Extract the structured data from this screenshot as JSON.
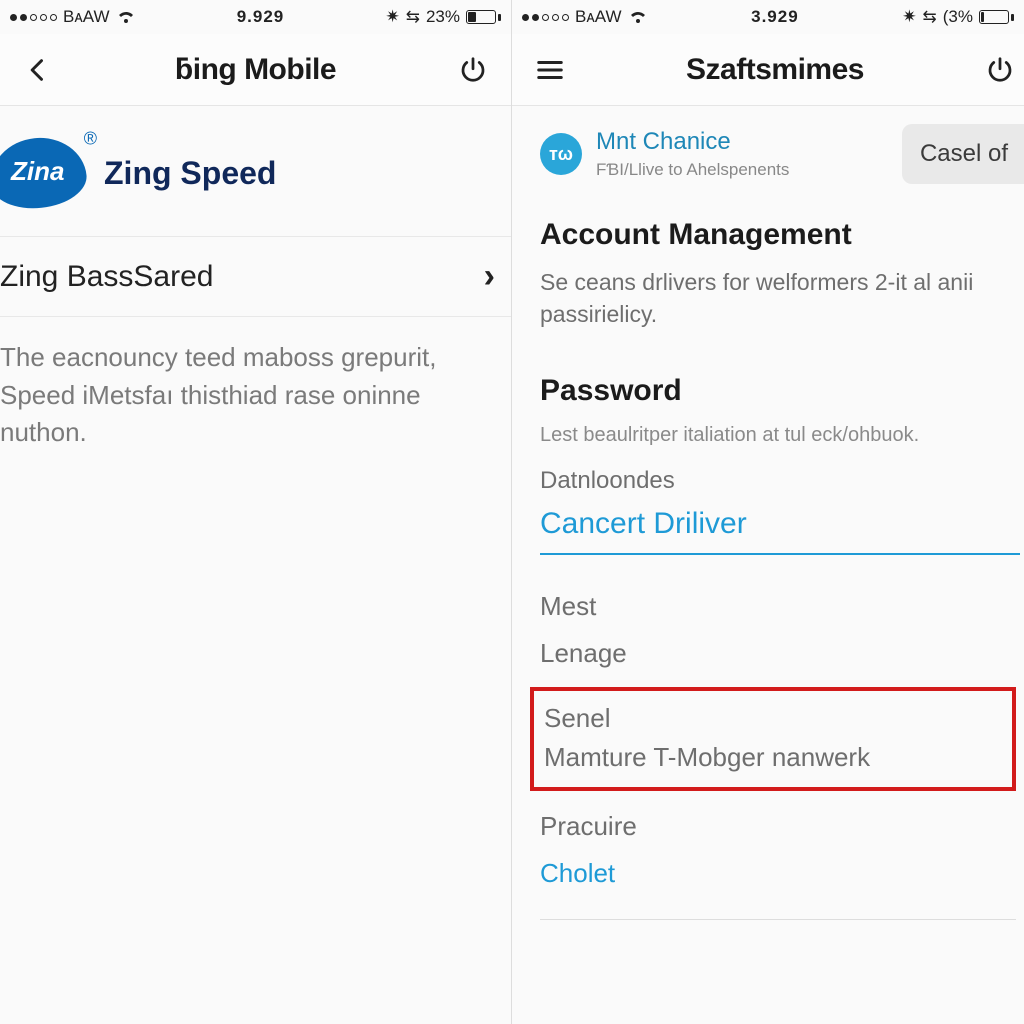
{
  "left": {
    "status": {
      "carrier": "BᴀAW",
      "time": "9.929",
      "battery_pct": "23%"
    },
    "nav": {
      "title": "ƃing Mobile"
    },
    "brand": {
      "logo_text": "Zina",
      "label": "Zing Speed"
    },
    "row1": {
      "label": "Zing BassSared"
    },
    "description": "The eacnouncy teed maboss grepurit, Speed iMetsfaı thisthiad rase oninne nuthon."
  },
  "right": {
    "status": {
      "carrier": "BᴀAW",
      "time": "3.929",
      "battery_pct": "(3%"
    },
    "nav": {
      "title": "Szaftsmimes"
    },
    "user": {
      "avatar_initials": "ᴛω",
      "name": "Mnt Chanice",
      "sub": "FƁI/Llive to Ahelspenents",
      "chip": "Casel of"
    },
    "section": {
      "heading": "Account Management",
      "sub": "Se ceans drlivers for welformers 2-it al anii passirielicy."
    },
    "password": {
      "heading": "Password",
      "sub": "Lest beaulritper italiation at tul eck/ohbuok.",
      "field_label": "Datnloondes",
      "field_value": "Cancert Driliver"
    },
    "list": {
      "item1": "Mest",
      "item2": "Lenage",
      "hi1": "Senel",
      "hi2": "Mamture T-Mobger nanwerk",
      "item3": "Pracuire",
      "link": "Cholet"
    }
  }
}
